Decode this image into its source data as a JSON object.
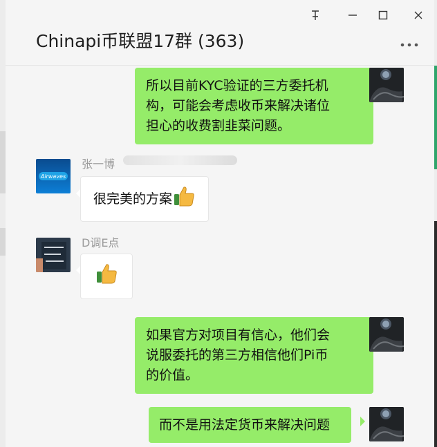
{
  "window": {
    "title": "Chinapi币联盟17群 (363)",
    "pin_icon": "pin-icon",
    "minimize_icon": "minimize-icon",
    "maximize_icon": "maximize-icon",
    "close_icon": "close-icon",
    "more_icon": "more-icon"
  },
  "colors": {
    "self_bubble": "#95ec69",
    "other_bubble": "#ffffff",
    "background": "#f5f5f5"
  },
  "messages": [
    {
      "from": "self",
      "text": "所以目前KYC验证的三方委托机构，可能会考虑收币来解决诸位担心的收费割韭菜问题。",
      "lines": [
        "所以目前KYC验证的三方委托机",
        "构，可能会考虑收币来解决诸位",
        "担心的收费割韭菜问题。"
      ]
    },
    {
      "from": "other",
      "sender": "张一博",
      "text": "很完美的方案",
      "emoji": "thumbs-up-emoji"
    },
    {
      "from": "other",
      "sender": "D调E点",
      "text": "",
      "emoji": "thumbs-up-emoji"
    },
    {
      "from": "self",
      "text": "如果官方对项目有信心，他们会说服委托的第三方相信他们Pi币的价值。",
      "lines": [
        "如果官方对项目有信心，他们会",
        "说服委托的第三方相信他们Pi币",
        "的价值。"
      ]
    },
    {
      "from": "self",
      "text": "而不是用法定货币来解决问题",
      "lines": [
        "而不是用法定货币来解决问题"
      ]
    }
  ]
}
